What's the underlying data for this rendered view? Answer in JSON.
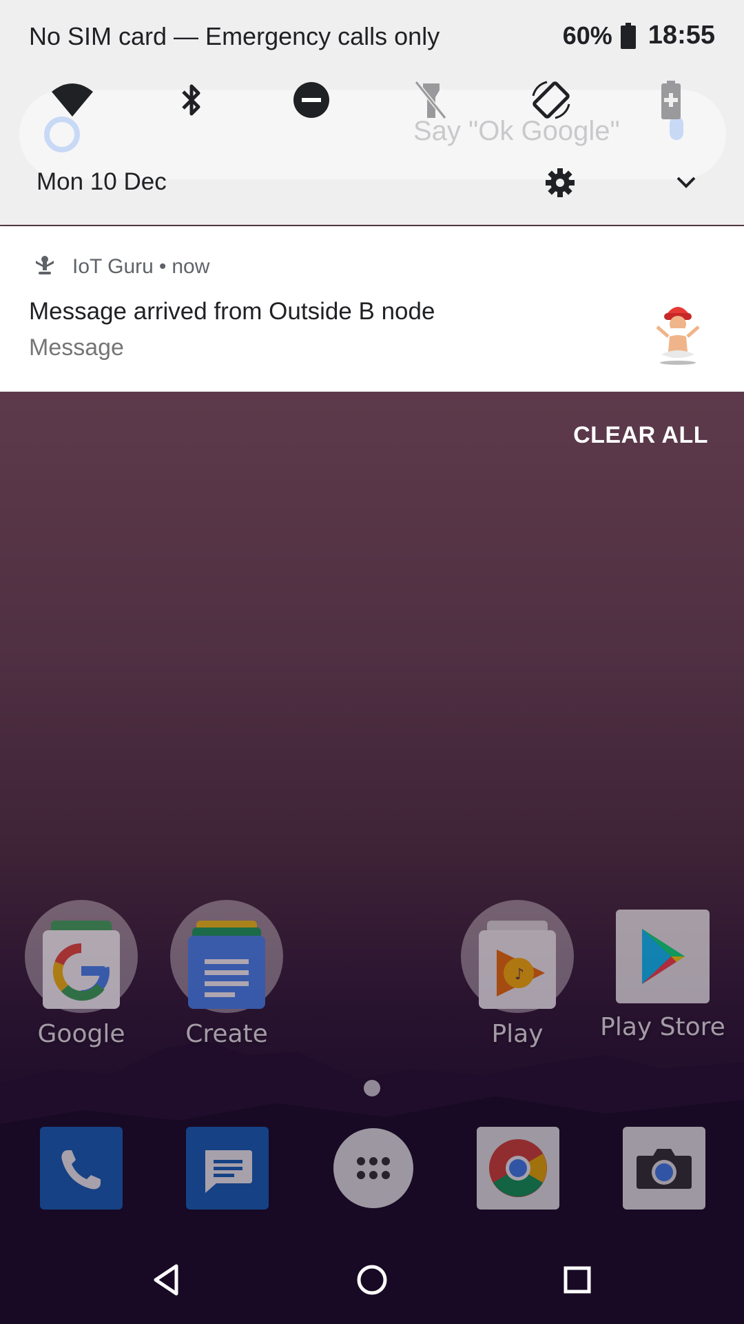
{
  "status_bar": {
    "carrier_text": "No SIM card — Emergency calls only",
    "battery_percent": "60%",
    "time": "18:55"
  },
  "quick_settings": {
    "tiles": [
      {
        "name": "wifi-icon",
        "state": "on"
      },
      {
        "name": "bluetooth-icon",
        "state": "on"
      },
      {
        "name": "do-not-disturb-icon",
        "state": "on"
      },
      {
        "name": "flashlight-icon",
        "state": "off"
      },
      {
        "name": "auto-rotate-icon",
        "state": "on"
      },
      {
        "name": "battery-saver-icon",
        "state": "off"
      }
    ],
    "date": "Mon 10 Dec",
    "background_hint": "Say \"Ok Google\""
  },
  "notification": {
    "app_name": "IoT Guru",
    "separator": "•",
    "time": "now",
    "title": "Message arrived from Outside B node",
    "text": "Message"
  },
  "clear_all_label": "CLEAR ALL",
  "home_apps": [
    {
      "label": "Google",
      "type": "folder"
    },
    {
      "label": "Create",
      "type": "folder"
    },
    {
      "label": "Play",
      "type": "folder"
    },
    {
      "label": "Play Store",
      "type": "app"
    }
  ],
  "dock": [
    {
      "name": "phone-icon"
    },
    {
      "name": "messages-icon"
    },
    {
      "name": "app-drawer-icon"
    },
    {
      "name": "chrome-icon"
    },
    {
      "name": "camera-icon"
    }
  ],
  "nav_bar": [
    "back-icon",
    "home-icon",
    "recents-icon"
  ],
  "colors": {
    "shade_bg": "#efeff0",
    "notification_bg": "#ffffff",
    "wallpaper_top": "#6b4654",
    "wallpaper_bottom": "#130820",
    "dock_blue": "#1565c0"
  }
}
